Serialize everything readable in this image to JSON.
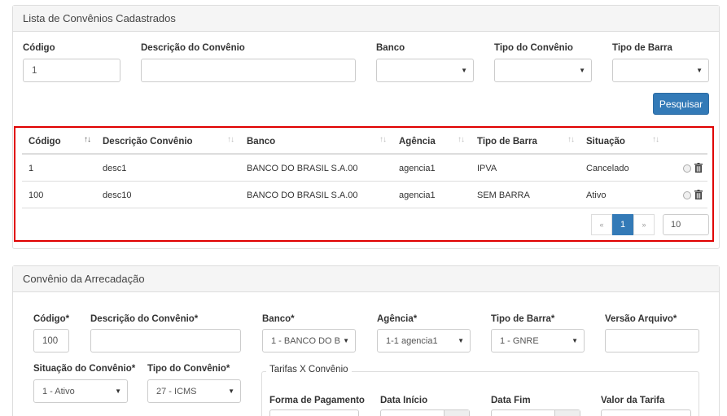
{
  "list_panel": {
    "title": "Lista de Convênios Cadastrados",
    "filters": {
      "codigo_label": "Código",
      "codigo_value": "1",
      "descricao_label": "Descrição do Convênio",
      "descricao_value": "",
      "banco_label": "Banco",
      "tipo_convenio_label": "Tipo do Convênio",
      "tipo_barra_label": "Tipo de Barra"
    },
    "search_button": "Pesquisar",
    "table": {
      "headers": [
        "Código",
        "Descrição Convênio",
        "Banco",
        "Agência",
        "Tipo de Barra",
        "Situação"
      ],
      "rows": [
        [
          "1",
          "desc1",
          "BANCO DO BRASIL S.A.00",
          "agencia1",
          "IPVA",
          "Cancelado"
        ],
        [
          "100",
          "desc10",
          "BANCO DO BRASIL S.A.00",
          "agencia1",
          "SEM BARRA",
          "Ativo"
        ]
      ]
    },
    "pagination": {
      "prev": "«",
      "current": "1",
      "next": "»",
      "page_size": "10"
    }
  },
  "form_panel": {
    "title": "Convênio da Arrecadação",
    "codigo_label": "Código*",
    "codigo_value": "100",
    "descricao_label": "Descrição do Convênio*",
    "descricao_value": "",
    "banco_label": "Banco*",
    "banco_value": "1 - BANCO DO B",
    "agencia_label": "Agência*",
    "agencia_value": "1-1 agencia1",
    "tipo_barra_label": "Tipo de Barra*",
    "tipo_barra_value": "1 - GNRE",
    "versao_label": "Versão Arquivo*",
    "versao_value": "",
    "situacao_label": "Situação do Convênio*",
    "situacao_value": "1 - Ativo",
    "tipo_convenio_label": "Tipo do Convênio*",
    "tipo_convenio_value": "27 - ICMS",
    "tarifas": {
      "legend": "Tarifas X Convênio",
      "forma_pagamento_label": "Forma de Pagamento",
      "data_inicio_label": "Data Início",
      "data_fim_label": "Data Fim",
      "valor_tarifa_label": "Valor da Tarifa"
    }
  },
  "colors": {
    "primary": "#337ab7",
    "highlight": "#e00000",
    "border": "#dddddd"
  }
}
